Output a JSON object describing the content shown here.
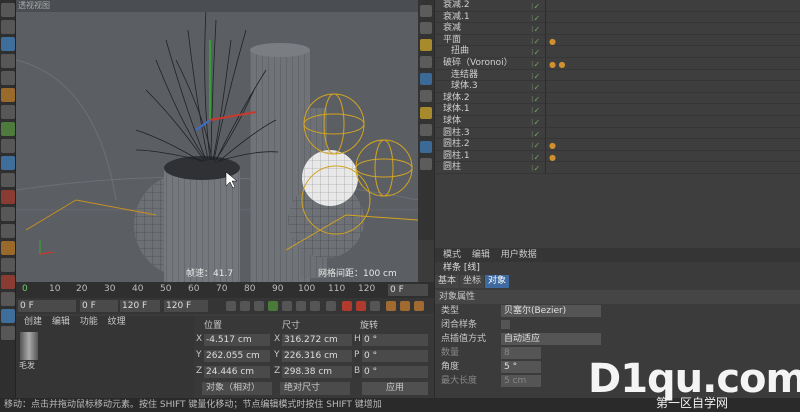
{
  "viewport": {
    "top_text": "透视视图",
    "fps": "帧速：41.7",
    "grid": "网格间距：100 cm"
  },
  "objects": [
    {
      "name": "衰减.2",
      "tags": ""
    },
    {
      "name": "衰减.1",
      "tags": ""
    },
    {
      "name": "衰减",
      "tags": ""
    },
    {
      "name": "平面",
      "tags": "●"
    },
    {
      "name": "扭曲",
      "tags": ""
    },
    {
      "name": "破碎（Voronoi）",
      "tags": "● ●"
    },
    {
      "name": "连结器",
      "tags": ""
    },
    {
      "name": "球体.3",
      "tags": ""
    },
    {
      "name": "球体.2",
      "tags": ""
    },
    {
      "name": "球体.1",
      "tags": ""
    },
    {
      "name": "球体",
      "tags": ""
    },
    {
      "name": "圆柱.3",
      "tags": ""
    },
    {
      "name": "圆柱.2",
      "tags": "●"
    },
    {
      "name": "圆柱.1",
      "tags": "●"
    },
    {
      "name": "圆柱",
      "tags": ""
    }
  ],
  "attributes": {
    "menu": [
      "模式",
      "编辑",
      "用户数据"
    ],
    "title": "样条 [线]",
    "tabs": [
      "基本",
      "坐标",
      "对象"
    ],
    "active_tab": "对象",
    "section": "对象属性",
    "props": [
      {
        "label": "类型",
        "value": "贝塞尔(Bezier)"
      },
      {
        "label": "闭合样条",
        "value": ""
      },
      {
        "label": "点插值方式",
        "value": "自动适应"
      },
      {
        "label": "数量",
        "value": "8"
      },
      {
        "label": "角度",
        "value": "5 °"
      },
      {
        "label": "最大长度",
        "value": "5 cm"
      }
    ]
  },
  "timeline": {
    "ticks": [
      "0",
      "10",
      "20",
      "30",
      "40",
      "50",
      "60",
      "70",
      "80",
      "90",
      "100",
      "110",
      "120"
    ],
    "current": "0 F",
    "start": "0 F",
    "field2": "0 F",
    "field3": "120 F",
    "end": "120 F"
  },
  "materials": {
    "menu": [
      "创建",
      "编辑",
      "功能",
      "纹理"
    ],
    "thumb_label": "毛发"
  },
  "coords": {
    "headers": [
      "位置",
      "尺寸",
      "旋转"
    ],
    "rows": [
      {
        "axis": "X",
        "pos": "-4.517 cm",
        "saxis": "X",
        "size": "316.272 cm",
        "raxis": "H",
        "rot": "0 °"
      },
      {
        "axis": "Y",
        "pos": "262.055 cm",
        "saxis": "Y",
        "size": "226.316 cm",
        "raxis": "P",
        "rot": "0 °"
      },
      {
        "axis": "Z",
        "pos": "24.446 cm",
        "saxis": "Z",
        "size": "298.38 cm",
        "raxis": "B",
        "rot": "0 °"
      }
    ],
    "mode1": "对象（相对）",
    "mode2": "绝对尺寸",
    "apply": "应用"
  },
  "status": "移动：点击并拖动鼠标移动元素。按住 SHIFT 键量化移动；节点编辑模式时按住 SHIFT 键增加",
  "watermark": {
    "big": "D1qu.com",
    "sub": "第一区自学网"
  }
}
